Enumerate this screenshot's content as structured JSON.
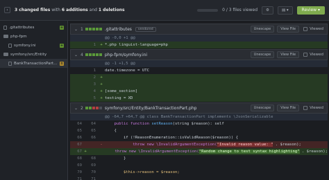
{
  "topbar": {
    "summary_count": "3 changed files",
    "summary_with": "with",
    "summary_additions": "6 additions",
    "summary_and": "and",
    "summary_deletions": "1 deletions",
    "viewed_count": "0 / 3 files viewed",
    "settings_label": "⚙",
    "layout_label": "▤ ▾",
    "review_label": "Review ▾"
  },
  "sidebar": {
    "items": [
      {
        "label": ".gitattributes",
        "type": "file",
        "badge": "+"
      },
      {
        "label": "php-fpm",
        "type": "folder"
      },
      {
        "label": "symfony.ini",
        "type": "file",
        "badge": "+"
      },
      {
        "label": "symfony/src/Entity",
        "type": "folder"
      },
      {
        "label": "BankTransactionPart...",
        "type": "file",
        "badge": "±"
      }
    ]
  },
  "files": [
    {
      "num": "1",
      "name": ".gitattributes",
      "tag": "vendored",
      "unescape": "Unescape",
      "view": "View File",
      "viewed": "Viewed",
      "hunk": "@@ -0,0 +1 @@",
      "lines": [
        {
          "n": "1",
          "s": "+",
          "t": "*.php linguist-language=php"
        }
      ]
    },
    {
      "num": "4",
      "name": "php-fpm/symfony.ini",
      "unescape": "Unescape",
      "view": "View File",
      "viewed": "Viewed",
      "hunk": "@@ -1 +1,5 @@",
      "lines": [
        {
          "n": "1",
          "s": "",
          "t": "date.timezone = UTC"
        },
        {
          "n": "2",
          "s": "+",
          "t": ""
        },
        {
          "n": "3",
          "s": "+",
          "t": ""
        },
        {
          "n": "4",
          "s": "+",
          "t": "[some_section]"
        },
        {
          "n": "5",
          "s": "+",
          "t": "testing = XD"
        }
      ]
    },
    {
      "num": "2",
      "name": "symfony/src/Entity/BankTransactionPart.php",
      "unescape": "Unescape",
      "view": "View File",
      "viewed": "Viewed",
      "hunk": "@@ -64,7 +64,7 @@ class BankTransactionPart implements \\JsonSerializable",
      "lines": [
        {
          "o": "64",
          "n": "64",
          "pre": "    public function ",
          "fn": "setReason",
          "post": "(string $reason): self"
        },
        {
          "o": "65",
          "n": "65",
          "t": "    {"
        },
        {
          "o": "66",
          "n": "66",
          "t": "        if (!ReasonEnumeration::isValidReason($reason)) {"
        },
        {
          "o": "67",
          "n": "",
          "type": "del",
          "pre": "            throw new \\InvalidArgumentException(",
          "hl": "\"Invalid reason value: \"",
          "post": " . $reason);"
        },
        {
          "o": "",
          "n": "67",
          "type": "add",
          "pre": "            throw new \\InvalidArgumentException(",
          "hl": "\"Random change to test syntax highlighting\"",
          "post": " . $reason);"
        },
        {
          "o": "68",
          "n": "68",
          "t": "        }"
        },
        {
          "o": "69",
          "n": "69",
          "t": ""
        },
        {
          "o": "70",
          "n": "70",
          "t": "        $this->reason = $reason;"
        },
        {
          "o": "71",
          "n": "71",
          "t": ""
        }
      ]
    }
  ]
}
